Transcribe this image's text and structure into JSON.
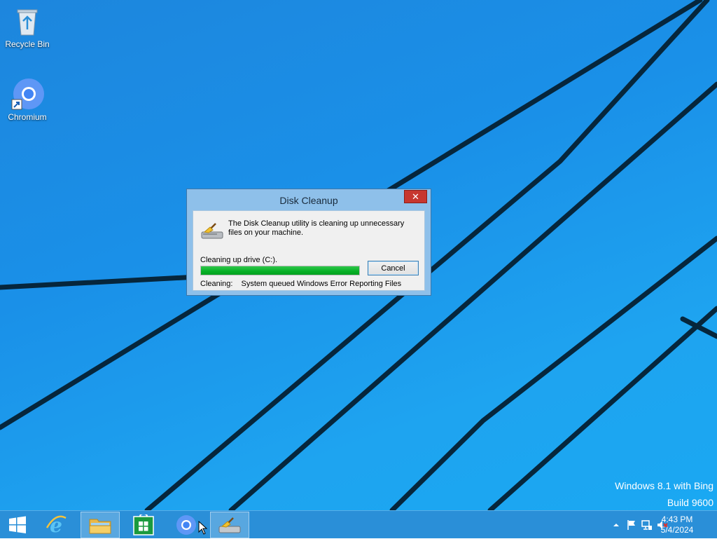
{
  "desktop": {
    "icons": [
      {
        "label": "Recycle Bin",
        "icon": "recycle-bin-icon"
      },
      {
        "label": "Chromium",
        "icon": "chromium-icon"
      }
    ],
    "watermark": {
      "line1": "Windows 8.1 with Bing",
      "line2": "Build 9600"
    }
  },
  "dialog": {
    "title": "Disk Cleanup",
    "close_label": "✕",
    "message": "The Disk Cleanup utility is cleaning up unnecessary files on your machine.",
    "drive_label": "Cleaning up drive  (C:).",
    "progress": 1.0,
    "cancel_label": "Cancel",
    "status_prefix": "Cleaning:",
    "status_value": "System queued Windows Error Reporting Files"
  },
  "taskbar": {
    "buttons": [
      {
        "name": "start",
        "icon": "windows-logo-icon"
      },
      {
        "name": "internet-explorer",
        "icon": "internet-explorer-icon"
      },
      {
        "name": "file-explorer",
        "icon": "folder-icon"
      },
      {
        "name": "store",
        "icon": "store-icon"
      },
      {
        "name": "chromium",
        "icon": "chromium-icon"
      },
      {
        "name": "disk-cleanup",
        "icon": "disk-cleanup-icon"
      }
    ],
    "clock": {
      "time": "4:43 PM",
      "date": "5/4/2024"
    }
  },
  "colors": {
    "progress_green": "#06b025",
    "close_red": "#c7372f",
    "taskbar": "#2a8fd8"
  }
}
